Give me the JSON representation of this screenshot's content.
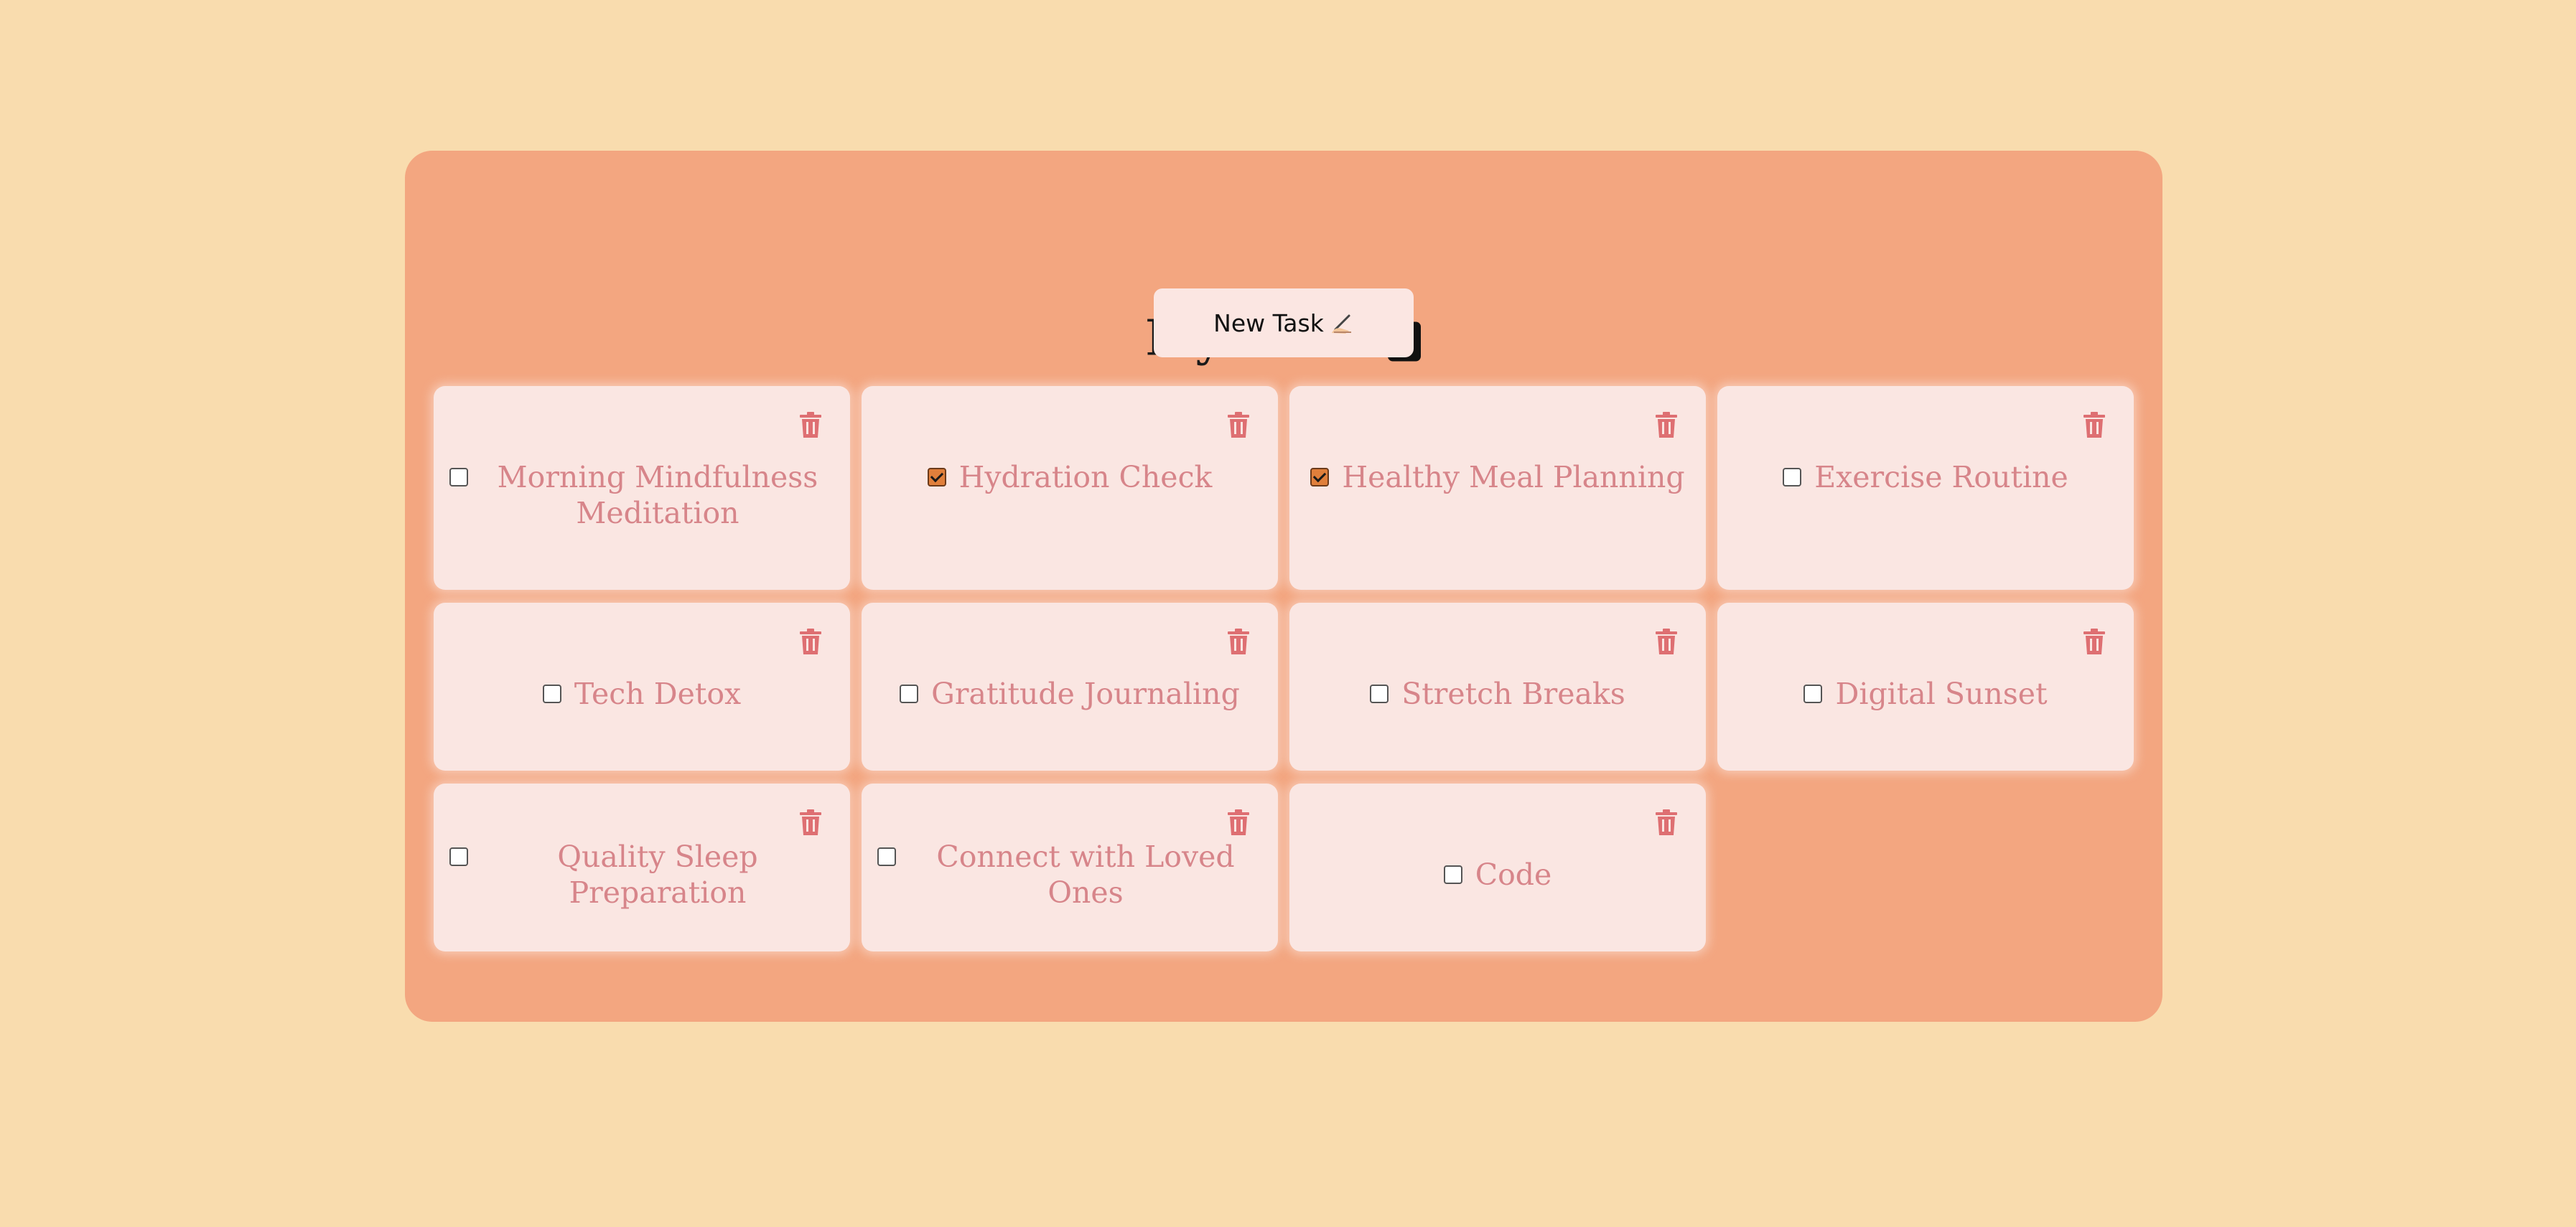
{
  "header": {
    "title": "My tasks",
    "title_icon": "clipboard-icon"
  },
  "toolbar": {
    "new_task_label": "New Task",
    "new_task_icon": "writing-hand-icon"
  },
  "colors": {
    "background": "#f9dcae",
    "panel": "#f3a680",
    "card": "#fae6e2",
    "task_text": "#d7858a",
    "trash_icon": "#de6f72",
    "checkbox_checked": "#e07f3b"
  },
  "tasks": [
    {
      "label": "Morning Mindfulness Meditation",
      "checked": false
    },
    {
      "label": "Hydration Check",
      "checked": true
    },
    {
      "label": "Healthy Meal Planning",
      "checked": true
    },
    {
      "label": "Exercise Routine",
      "checked": false
    },
    {
      "label": "Tech Detox",
      "checked": false
    },
    {
      "label": "Gratitude Journaling",
      "checked": false
    },
    {
      "label": "Stretch Breaks",
      "checked": false
    },
    {
      "label": "Digital Sunset",
      "checked": false
    },
    {
      "label": "Quality Sleep Preparation",
      "checked": false
    },
    {
      "label": "Connect with Loved Ones",
      "checked": false
    },
    {
      "label": "Code",
      "checked": false
    }
  ]
}
